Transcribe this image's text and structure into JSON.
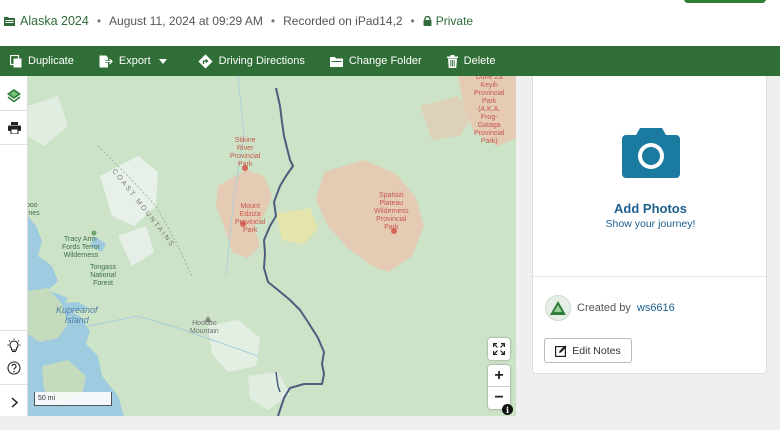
{
  "header": {
    "title": "Alaska 2024",
    "date": "August 11, 2024 at 09:29 AM",
    "recorded": "Recorded on iPad14,2",
    "privacy": "Private"
  },
  "toolbar": {
    "duplicate": "Duplicate",
    "export": "Export",
    "directions": "Driving Directions",
    "change_folder": "Change Folder",
    "delete": "Delete"
  },
  "map": {
    "labels": {
      "stikine": "Stikine\nRiver\nProvincial\nPark",
      "edziza": "Mount\nEdziza\nProvincial\nPark",
      "spatsizi": "Spatsizi\nPlateau\nWilderness\nProvincial\nPark",
      "dease": "Dune Za\nKeyih\nProvincial\nPark\n(A.K.A.\nFrog-\nGataga\nProvincial\nPark)",
      "tracy": "Tracy Arm-\nFords Terror\nWilderness",
      "tongass": "Tongass\nNational\nForest",
      "kupreanof": "Kupreanof\nIsland",
      "hoodoo": "Hoodoo\nMountain",
      "coast_mountains": "COAST MOUNTAINS",
      "edge": "boo\nrnes"
    },
    "scale": "50 mi",
    "zoom_in": "+",
    "zoom_out": "−",
    "info": "i"
  },
  "panel": {
    "add_photos": "Add Photos",
    "show_journey": "Show your journey!",
    "created_by": "Created by",
    "user": "ws6616",
    "edit_notes": "Edit Notes"
  },
  "colors": {
    "brand_green": "#2f6e37",
    "link_blue": "#1d5f8c",
    "camera_blue": "#1a7aa0",
    "track": "#4a5f7e"
  }
}
